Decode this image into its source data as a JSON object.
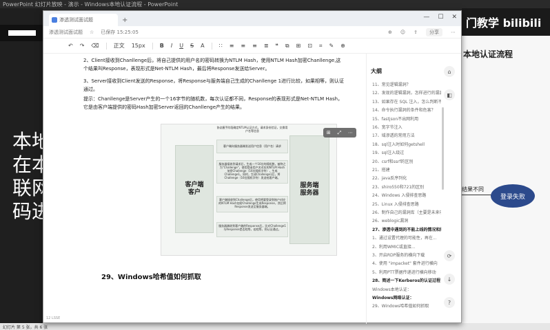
{
  "background": {
    "title_bar": "PowerPoint 幻灯片放映  -  演示  -  Windows本地认证流程  -  PowerPoint",
    "left_big_text": [
      "本地",
      "在本",
      "联网",
      "码进"
    ],
    "brand": "门教学 bilibili",
    "slide_heading": "本地认证流程",
    "flow_label": "结果不同",
    "flow_bubble": "登录失败",
    "taskbar_text": "幻灯片 第 5 张，共 6 张"
  },
  "window": {
    "tab_title": "渗透测试面试题",
    "tab_plus": "+",
    "controls": [
      "—",
      "☐",
      "✕"
    ]
  },
  "doc_header": {
    "title": "渗透测试面试题",
    "saved": "已保存 15:25:05",
    "star": "☆",
    "share": "分享",
    "right_icons": [
      "⊕",
      "☺",
      "⇪",
      "⋯"
    ]
  },
  "toolbar": {
    "items": [
      "↶",
      "↷",
      "⌫",
      "正文",
      "15px",
      "B",
      "I",
      "U",
      "S",
      "A",
      "∷",
      "≡",
      "≡",
      "≡",
      "≣",
      "❝",
      "⧉",
      "⊞",
      "⊡",
      "⌗",
      "✎",
      "⊕"
    ]
  },
  "content": {
    "para_2": "2、Client接收到Chanllenge后，将自己提供的用户名的密码转换为NTLM Hash，使用NTLM Hash加密Chanllenge,这个结果叫Response，表现形式是Net-NTLM Hash，最后将Response发送给Server。",
    "para_3": "3、Server接收到Client发送的Response，将Response与服务端自己生成的Chanllenge 1进行比较，如果相等，则认证通过。",
    "para_tip": "提示：Chanllenge是Server产生的一个16字节的随机数，每次认证都不同，Response的表现形式是Net-NTLM Hash，它是由客户端提供的密码Hash加密Server返回的Chanllenge产生的结果。",
    "diagram": {
      "client": "客户端\n客户",
      "server": "服务端\n服务器",
      "note_top": "协议握手阶段确定NTLM认证方式，请求身份验证，交换用户名等信息",
      "note_1": "客户端向服务器端发送用户信息（用户名）请求",
      "note_2": "服务器接收到请求后，生成一个16位的随机数，被称之为\"Challenge\"，使用登录用户名对应的NTLM Hash加密Challenge（16位随机字符），生成Challenge1。同时，生成Challenge1后，将Challenge（16位随机字符）发送给客户端。",
      "note_3": "客户端接收到Challenge后，使用将要登录到账户对应的NTLM Hash加密Challenge生成Response，然后将Response发送至服务器端。",
      "note_4": "服务器端收到客户端的Response后，比对Challenge1与Response是否相等，若相等，则认证通过。",
      "float_icons": [
        "⊞",
        "⤢",
        "⋯"
      ]
    },
    "heading_29": "29、Windows哈希值如何抓取"
  },
  "outline": {
    "title": "大纲",
    "items": [
      {
        "text": "11、常见逻辑漏洞？",
        "bold": false
      },
      {
        "text": "12、发现的逻辑漏洞，怎样进行的漏洞...",
        "bold": false
      },
      {
        "text": "13、如果存在 SQL 注入，怎么判断不同...",
        "bold": false
      },
      {
        "text": "14、命令执行漏洞的条件和危害？",
        "bold": false
      },
      {
        "text": "15、fastjson不出网利用",
        "bold": false
      },
      {
        "text": "16、宽字节注入",
        "bold": false
      },
      {
        "text": "17、域渗透的常用方法",
        "bold": false
      },
      {
        "text": "18、sql注入时如何getshell",
        "bold": false
      },
      {
        "text": "19、sql注入绕过",
        "bold": false
      },
      {
        "text": "20、csrf和ssrf的区别",
        "bold": false
      },
      {
        "text": "21、搭建",
        "bold": false
      },
      {
        "text": "22、java反序列化",
        "bold": false
      },
      {
        "text": "23、shiro550和721的区别",
        "bold": false
      },
      {
        "text": "24、Windows 入侵排查思路",
        "bold": false
      },
      {
        "text": "25、Linux 入侵排查思路",
        "bold": false
      },
      {
        "text": "26、制作自己的漏洞库（主要是未来项目...）",
        "bold": false
      },
      {
        "text": "26、weblogic漏洞",
        "bold": false
      },
      {
        "text": "27、渗透中遇到的不能上线的情况和解决...",
        "bold": true
      },
      {
        "text": "1、通过设置代理的可能性，再在...",
        "bold": false
      },
      {
        "text": "2、利用WMIC或直接...",
        "bold": false
      },
      {
        "text": "3、开启RDP服务的横向下载",
        "bold": false
      },
      {
        "text": "4、使用 \"impacket\" 套件进行横向",
        "bold": false
      },
      {
        "text": "5、利用PTT票据传递进行横向移动",
        "bold": false
      },
      {
        "text": "28、简述一下Kerberos的认证过程",
        "bold": true
      },
      {
        "text": "Windows本地认证：",
        "bold": false
      },
      {
        "text": "Windows网络认证：",
        "bold": true
      },
      {
        "text": "29、Windows哈希值如何抓取",
        "bold": false
      }
    ]
  },
  "side_tools": [
    "⌂",
    "◧",
    "⟳",
    "↓",
    "?"
  ],
  "statusbar": "12 LSSE"
}
